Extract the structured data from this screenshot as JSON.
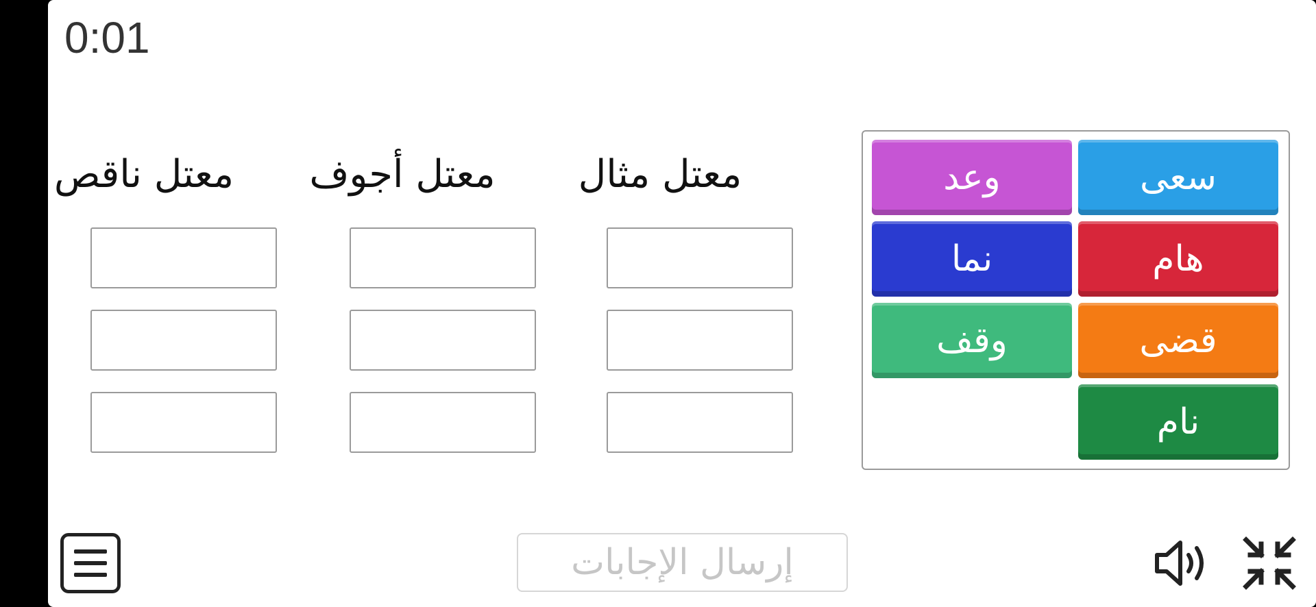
{
  "timer": "0:01",
  "columns": [
    {
      "label": "معتل مثال"
    },
    {
      "label": "معتل أجوف"
    },
    {
      "label": "معتل ناقص"
    }
  ],
  "tiles": [
    {
      "label": "سعى",
      "color": "#2a9fe6"
    },
    {
      "label": "وعد",
      "color": "#c655d4"
    },
    {
      "label": "هام",
      "color": "#d7263a"
    },
    {
      "label": "نما",
      "color": "#2a3bd0"
    },
    {
      "label": "قضى",
      "color": "#f47b14"
    },
    {
      "label": "وقف",
      "color": "#3fba7d"
    },
    {
      "label": "نام",
      "color": "#1e8a44"
    }
  ],
  "submit_label": "إرسال الإجابات",
  "icons": {
    "menu": "menu-icon",
    "sound": "speaker-icon",
    "collapse": "collapse-icon"
  }
}
